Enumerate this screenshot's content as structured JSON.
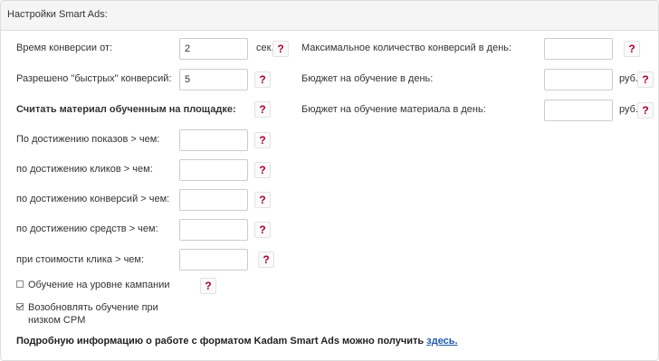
{
  "panel": {
    "title": "Настройки Smart Ads:"
  },
  "left": {
    "conversion_time": {
      "label": "Время конверсии от:",
      "value": "2",
      "unit": "сек.",
      "help": "?"
    },
    "fast_conversions": {
      "label": "Разрешено \"быстрых\" конверсий:",
      "value": "5",
      "help": "?"
    },
    "learned_heading": {
      "label": "Считать материал обученным на площадке:",
      "help": "?"
    },
    "by_impressions": {
      "label": "По достижению показов > чем:",
      "value": "",
      "help": "?"
    },
    "by_clicks": {
      "label": "по достижению кликов > чем:",
      "value": "",
      "help": "?"
    },
    "by_conversions": {
      "label": "по достижению конверсий > чем:",
      "value": "",
      "help": "?"
    },
    "by_funds": {
      "label": "по достижению средств > чем:",
      "value": "",
      "help": "?"
    },
    "by_click_cost": {
      "label": "при стоимости клика > чем:",
      "value": "",
      "help": "?"
    },
    "campaign_learning": {
      "label": "Обучение на уровне кампании",
      "checked": false,
      "help": "?"
    },
    "resume_low_cpm": {
      "label_line1": "Возобновлять обучение при",
      "label_line2": "низком CPM",
      "checked": true
    }
  },
  "right": {
    "max_conversions": {
      "label": "Максимальное количество конверсий в день:",
      "value": "",
      "help": "?"
    },
    "learning_budget": {
      "label": "Бюджет на обучение в день:",
      "value": "",
      "unit": "руб.",
      "help": "?"
    },
    "material_budget": {
      "label": "Бюджет на обучение материала в день:",
      "value": "",
      "unit": "руб.",
      "help": "?"
    }
  },
  "footer": {
    "text": "Подробную информацию о работе с форматом Kadam Smart Ads можно получить",
    "link": "здесь."
  }
}
